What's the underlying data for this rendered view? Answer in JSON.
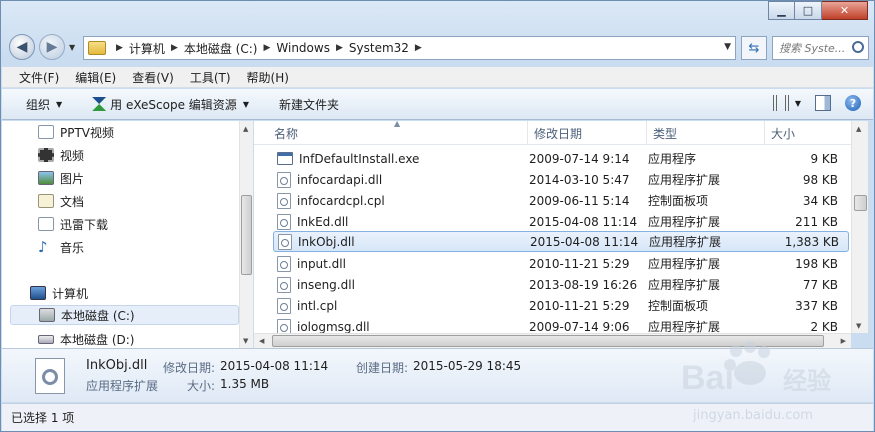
{
  "window": {
    "caption": {
      "minimize": "▁",
      "maximize": "□",
      "close": "✕"
    }
  },
  "address": {
    "crumbs": [
      "计算机",
      "本地磁盘 (C:)",
      "Windows",
      "System32"
    ],
    "search_placeholder": "搜索 Syste..."
  },
  "menu": [
    "文件(F)",
    "编辑(E)",
    "查看(V)",
    "工具(T)",
    "帮助(H)"
  ],
  "toolbar": {
    "organize": "组织",
    "open_with": "用 eXeScope 编辑资源",
    "new_folder": "新建文件夹"
  },
  "nav": {
    "items": [
      {
        "label": "PPTV视频",
        "icon": "pptv-icon"
      },
      {
        "label": "视频",
        "icon": "video-library-icon"
      },
      {
        "label": "图片",
        "icon": "pictures-library-icon"
      },
      {
        "label": "文档",
        "icon": "documents-library-icon"
      },
      {
        "label": "迅雷下载",
        "icon": "thunder-download-icon"
      },
      {
        "label": "音乐",
        "icon": "music-library-icon"
      }
    ],
    "computer": "计算机",
    "drives": [
      {
        "label": "本地磁盘 (C:)",
        "selected": true
      },
      {
        "label": "本地磁盘 (D:)",
        "selected": false
      }
    ]
  },
  "columns": {
    "name": "名称",
    "date": "修改日期",
    "type": "类型",
    "size": "大小"
  },
  "files": [
    {
      "name": "InfDefaultInstall.exe",
      "date": "2009-07-14 9:14",
      "type": "应用程序",
      "size": "9 KB",
      "icon": "exe-file-icon"
    },
    {
      "name": "infocardapi.dll",
      "date": "2014-03-10 5:47",
      "type": "应用程序扩展",
      "size": "98 KB",
      "icon": "dll-file-icon"
    },
    {
      "name": "infocardcpl.cpl",
      "date": "2009-06-11 5:14",
      "type": "控制面板项",
      "size": "34 KB",
      "icon": "cpl-file-icon"
    },
    {
      "name": "InkEd.dll",
      "date": "2015-04-08 11:14",
      "type": "应用程序扩展",
      "size": "211 KB",
      "icon": "dll-file-icon"
    },
    {
      "name": "InkObj.dll",
      "date": "2015-04-08 11:14",
      "type": "应用程序扩展",
      "size": "1,383 KB",
      "icon": "dll-file-icon",
      "selected": true
    },
    {
      "name": "input.dll",
      "date": "2010-11-21 5:29",
      "type": "应用程序扩展",
      "size": "198 KB",
      "icon": "dll-file-icon"
    },
    {
      "name": "inseng.dll",
      "date": "2013-08-19 16:26",
      "type": "应用程序扩展",
      "size": "77 KB",
      "icon": "dll-file-icon"
    },
    {
      "name": "intl.cpl",
      "date": "2010-11-21 5:29",
      "type": "控制面板项",
      "size": "337 KB",
      "icon": "cpl-file-icon"
    },
    {
      "name": "iologmsg.dll",
      "date": "2009-07-14 9:06",
      "type": "应用程序扩展",
      "size": "2 KB",
      "icon": "dll-file-icon"
    }
  ],
  "details": {
    "name": "InkObj.dll",
    "type": "应用程序扩展",
    "modified_label": "修改日期:",
    "modified": "2015-04-08 11:14",
    "created_label": "创建日期:",
    "created": "2015-05-29 18:45",
    "size_label": "大小:",
    "size": "1.35 MB"
  },
  "status": {
    "text": "已选择 1 项"
  },
  "watermark": {
    "brand": "Bai",
    "brand2": "经验",
    "url": "jingyan.baidu.com"
  },
  "colors": {
    "selection": "#d7e6f8",
    "accent": "#2f6bb3",
    "window_frame": "#c9dcf0"
  }
}
